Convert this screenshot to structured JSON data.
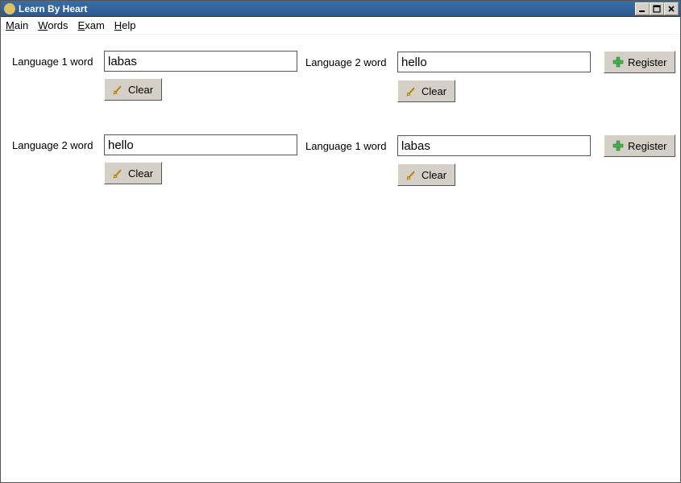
{
  "window": {
    "title": "Learn By Heart"
  },
  "menu": {
    "main": "Main",
    "words": "Words",
    "exam": "Exam",
    "help": "Help"
  },
  "rows": [
    {
      "left": {
        "label": "Language 1 word",
        "value": "labas"
      },
      "right": {
        "label": "Language 2 word",
        "value": "hello"
      },
      "clear_label": "Clear",
      "register_label": "Register"
    },
    {
      "left": {
        "label": "Language 2 word",
        "value": "hello"
      },
      "right": {
        "label": "Language 1 word",
        "value": "labas"
      },
      "clear_label": "Clear",
      "register_label": "Register"
    }
  ]
}
